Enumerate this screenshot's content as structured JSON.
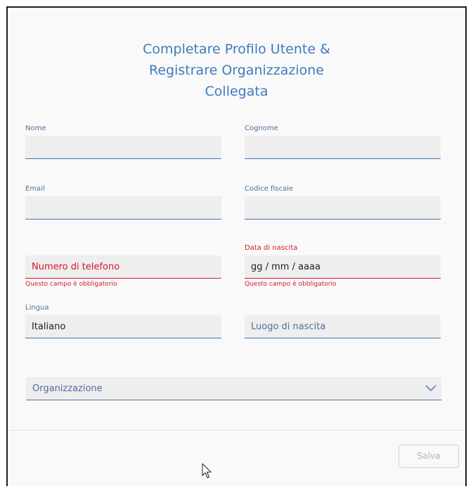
{
  "dialog": {
    "title_lines": [
      "Completare Profilo Utente &",
      "Registrare Organizzazione",
      "Collegata"
    ]
  },
  "form": {
    "nome": {
      "label": "Nome",
      "value": ""
    },
    "cognome": {
      "label": "Cognome",
      "value": ""
    },
    "email": {
      "label": "Email",
      "value": ""
    },
    "codice_fiscale": {
      "label": "Codice fiscale",
      "value": ""
    },
    "telefono": {
      "placeholder": "Numero di telefono",
      "error": "Questo campo è obbligatorio"
    },
    "data_nascita": {
      "label": "Data di nascita",
      "value": "gg / mm / aaaa",
      "error": "Questo campo è obbligatorio"
    },
    "lingua": {
      "label": "Lingua",
      "value": "Italiano"
    },
    "luogo_nascita": {
      "placeholder": "Luogo di nascita"
    },
    "organizzazione": {
      "placeholder": "Organizzazione",
      "icon": "chevron-down-icon"
    }
  },
  "footer": {
    "save_label": "Salva"
  },
  "colors": {
    "accent": "#3f7bbd",
    "error": "#d51a2f",
    "field_bg": "#eeeeee",
    "dialog_bg": "#f9f9f9"
  }
}
